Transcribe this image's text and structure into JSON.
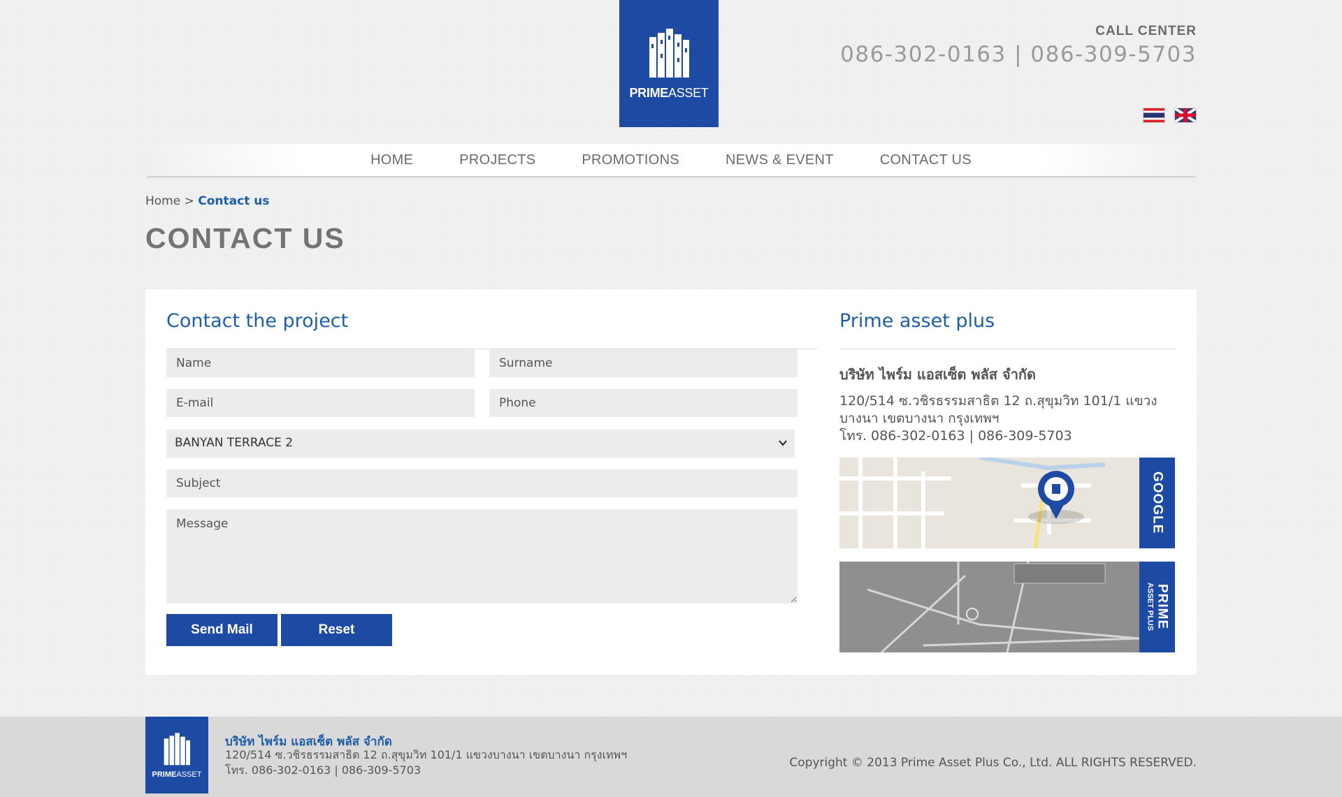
{
  "header": {
    "logo": {
      "brand_bold": "PRIME",
      "brand_regular": "ASSET"
    },
    "call_center": {
      "label": "CALL CENTER",
      "phones": "086-302-0163 | 086-309-5703"
    },
    "languages": [
      "th-flag-icon",
      "uk-flag-icon"
    ]
  },
  "nav": {
    "items": [
      "HOME",
      "PROJECTS",
      "PROMOTIONS",
      "NEWS & EVENT",
      "CONTACT US"
    ]
  },
  "breadcrumb": {
    "home": "Home",
    "separator": ">",
    "current": "Contact us"
  },
  "page_title": "CONTACT US",
  "form": {
    "title": "Contact the project",
    "name_placeholder": "Name",
    "surname_placeholder": "Surname",
    "email_placeholder": "E-mail",
    "phone_placeholder": "Phone",
    "project_selected": "BANYAN TERRACE 2",
    "subject_placeholder": "Subject",
    "message_placeholder": "Message",
    "send_label": "Send Mail",
    "reset_label": "Reset"
  },
  "sidebar": {
    "title": "Prime asset plus",
    "company": "บริษัท ไพร์ม แอสเซ็ต พลัส จำกัด",
    "address_line1": "120/514 ซ.วชิรธรรมสาธิต 12 ถ.สุขุมวิท 101/1 แขวง",
    "address_line2": "บางนา เขตบางนา กรุงเทพฯ",
    "phone_line": "โทร. 086-302-0163 | 086-309-5703",
    "google_map_tab": "GOOGLE",
    "prime_map_tab": "PRIME",
    "prime_map_tab_sub": "ASSET PLUS"
  },
  "footer": {
    "company": "บริษัท ไพร์ม แอสเซ็ต พลัส จำกัด",
    "address": "120/514 ซ.วชิรธรรมสาธิต 12 ถ.สุขุมวิท 101/1 แขวงบางนา เขตบางนา กรุงเทพฯ",
    "phone": "โทร. 086-302-0163 | 086-309-5703",
    "copyright": "Copyright © 2013 Prime Asset Plus Co., Ltd. ALL RIGHTS RESERVED."
  },
  "colors": {
    "brand_blue": "#1d4aa3",
    "link_blue": "#1d5ea7"
  }
}
